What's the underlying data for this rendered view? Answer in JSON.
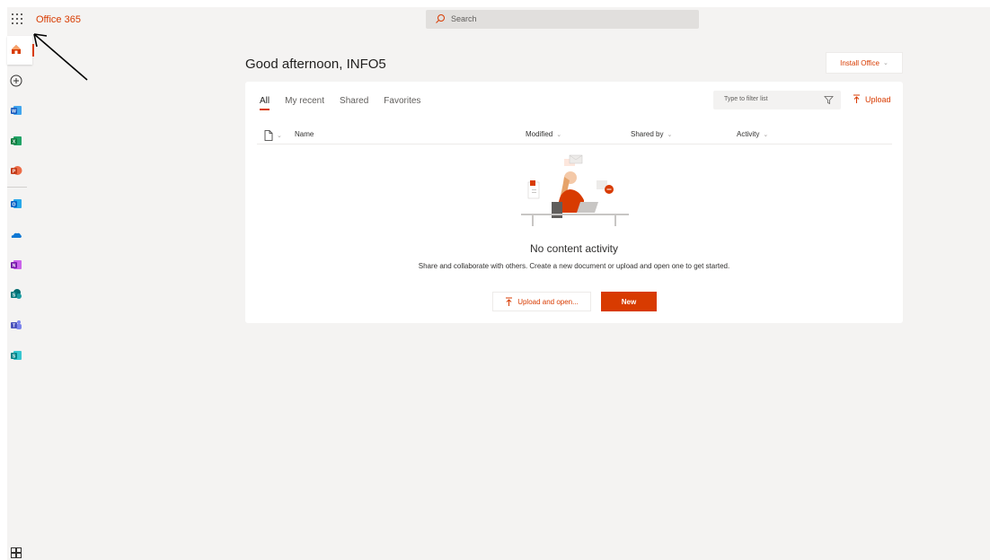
{
  "header": {
    "brand": "Office 365",
    "search_placeholder": "Search"
  },
  "rail": {
    "items": [
      "home-icon",
      "create-icon",
      "word-icon",
      "excel-icon",
      "powerpoint-icon",
      "outlook-icon",
      "onedrive-icon",
      "onenote-icon",
      "sharepoint-icon",
      "teams-icon",
      "sway-icon"
    ],
    "bottom": "all-apps-icon"
  },
  "main": {
    "greeting": "Good afternoon, INFO5",
    "install_label": "Install Office",
    "tabs": [
      {
        "label": "All",
        "active": true
      },
      {
        "label": "My recent",
        "active": false
      },
      {
        "label": "Shared",
        "active": false
      },
      {
        "label": "Favorites",
        "active": false
      }
    ],
    "filter_placeholder": "Type to filter list",
    "upload_label": "Upload",
    "columns": {
      "name": "Name",
      "modified": "Modified",
      "shared_by": "Shared by",
      "activity": "Activity"
    },
    "empty_title": "No content activity",
    "empty_desc": "Share and collaborate with others. Create a new document or upload and open one to get started.",
    "upload_open_label": "Upload and open...",
    "new_label": "New"
  },
  "colors": {
    "accent": "#d83b01",
    "background": "#f4f3f2"
  }
}
